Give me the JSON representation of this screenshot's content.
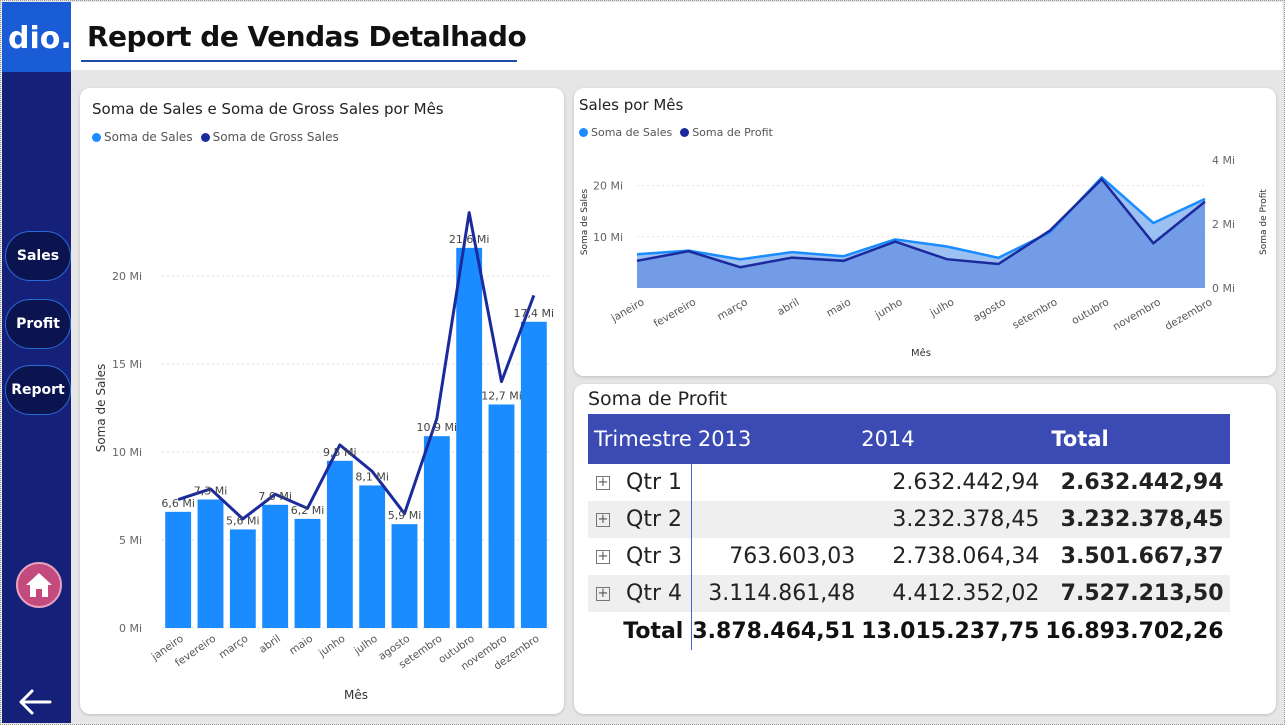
{
  "header": {
    "title": "Report de Vendas Detalhado"
  },
  "sidebar": {
    "logo_text": "dio.",
    "items": [
      {
        "label": "Sales"
      },
      {
        "label": "Profit"
      },
      {
        "label": "Report"
      }
    ],
    "home_icon": "home-icon",
    "back_icon": "arrow-left-icon"
  },
  "colors": {
    "sidebar_bg": "#152179",
    "logo_bg": "#1a5bd6",
    "sales": "#1a8cff",
    "gross_sales": "#1b2a9c",
    "profit": "#1b2a9c",
    "table_header": "#3c4bb4",
    "home_button": "#c24a7c"
  },
  "chart_data": [
    {
      "type": "bar",
      "title": "Soma de Sales e Soma de Gross Sales por Mês",
      "legend": [
        "Soma de Sales",
        "Soma de Gross Sales"
      ],
      "legend_position": "top-left",
      "xlabel": "Mês",
      "ylabel": "Soma de Sales",
      "ylim": [
        0,
        25
      ],
      "y_ticks": [
        "0 Mi",
        "5 Mi",
        "10 Mi",
        "15 Mi",
        "20 Mi"
      ],
      "categories": [
        "janeiro",
        "fevereiro",
        "março",
        "abril",
        "maio",
        "junho",
        "julho",
        "agosto",
        "setembro",
        "outubro",
        "novembro",
        "dezembro"
      ],
      "series": [
        {
          "name": "Soma de Sales",
          "kind": "bar",
          "values": [
            6.6,
            7.3,
            5.6,
            7.0,
            6.2,
            9.5,
            8.1,
            5.9,
            10.9,
            21.6,
            12.7,
            17.4
          ]
        },
        {
          "name": "Soma de Gross Sales",
          "kind": "line",
          "values": [
            7.3,
            7.9,
            6.2,
            7.6,
            6.8,
            10.4,
            8.9,
            6.5,
            11.9,
            23.6,
            14.0,
            18.9
          ]
        }
      ],
      "data_labels": [
        "6,6 Mi",
        "7,3 Mi",
        "5,6 Mi",
        "7,0 Mi",
        "6,2 Mi",
        "9,5 Mi",
        "8,1 Mi",
        "5,9 Mi",
        "10,9 Mi",
        "21,6 Mi",
        "12,7 Mi",
        "17,4 Mi"
      ],
      "grid": true
    },
    {
      "type": "area",
      "title": "Sales por Mês",
      "legend": [
        "Soma de Sales",
        "Soma de Profit"
      ],
      "legend_position": "top-left",
      "xlabel": "Mês",
      "ylabel": "Soma de Sales",
      "y2label": "Soma de Profit",
      "ylim": [
        0,
        25
      ],
      "y_ticks": [
        "10 Mi",
        "20 Mi"
      ],
      "y2lim": [
        0,
        4
      ],
      "y2_ticks": [
        "0 Mi",
        "2 Mi",
        "4 Mi"
      ],
      "categories": [
        "janeiro",
        "fevereiro",
        "março",
        "abril",
        "maio",
        "junho",
        "julho",
        "agosto",
        "setembro",
        "outubro",
        "novembro",
        "dezembro"
      ],
      "series": [
        {
          "name": "Soma de Sales",
          "values": [
            6.6,
            7.3,
            5.6,
            7.0,
            6.2,
            9.5,
            8.1,
            5.9,
            10.9,
            21.6,
            12.7,
            17.4
          ]
        },
        {
          "name": "Soma de Profit",
          "values": [
            0.85,
            1.15,
            0.65,
            0.95,
            0.85,
            1.45,
            0.9,
            0.75,
            1.8,
            3.4,
            1.4,
            2.7
          ]
        }
      ],
      "grid": true
    }
  ],
  "profit_table": {
    "title": "Soma de Profit",
    "headers": [
      "Trimestre",
      "2013",
      "2014",
      "Total"
    ],
    "rows": [
      {
        "label": "Qtr 1",
        "y2013": "",
        "y2014": "2.632.442,94",
        "total": "2.632.442,94"
      },
      {
        "label": "Qtr 2",
        "y2013": "",
        "y2014": "3.232.378,45",
        "total": "3.232.378,45"
      },
      {
        "label": "Qtr 3",
        "y2013": "763.603,03",
        "y2014": "2.738.064,34",
        "total": "3.501.667,37"
      },
      {
        "label": "Qtr 4",
        "y2013": "3.114.861,48",
        "y2014": "4.412.352,02",
        "total": "7.527.213,50"
      }
    ],
    "totals": {
      "label": "Total",
      "y2013": "3.878.464,51",
      "y2014": "13.015.237,75",
      "total": "16.893.702,26"
    },
    "expand_icon": "plus-box-icon"
  }
}
